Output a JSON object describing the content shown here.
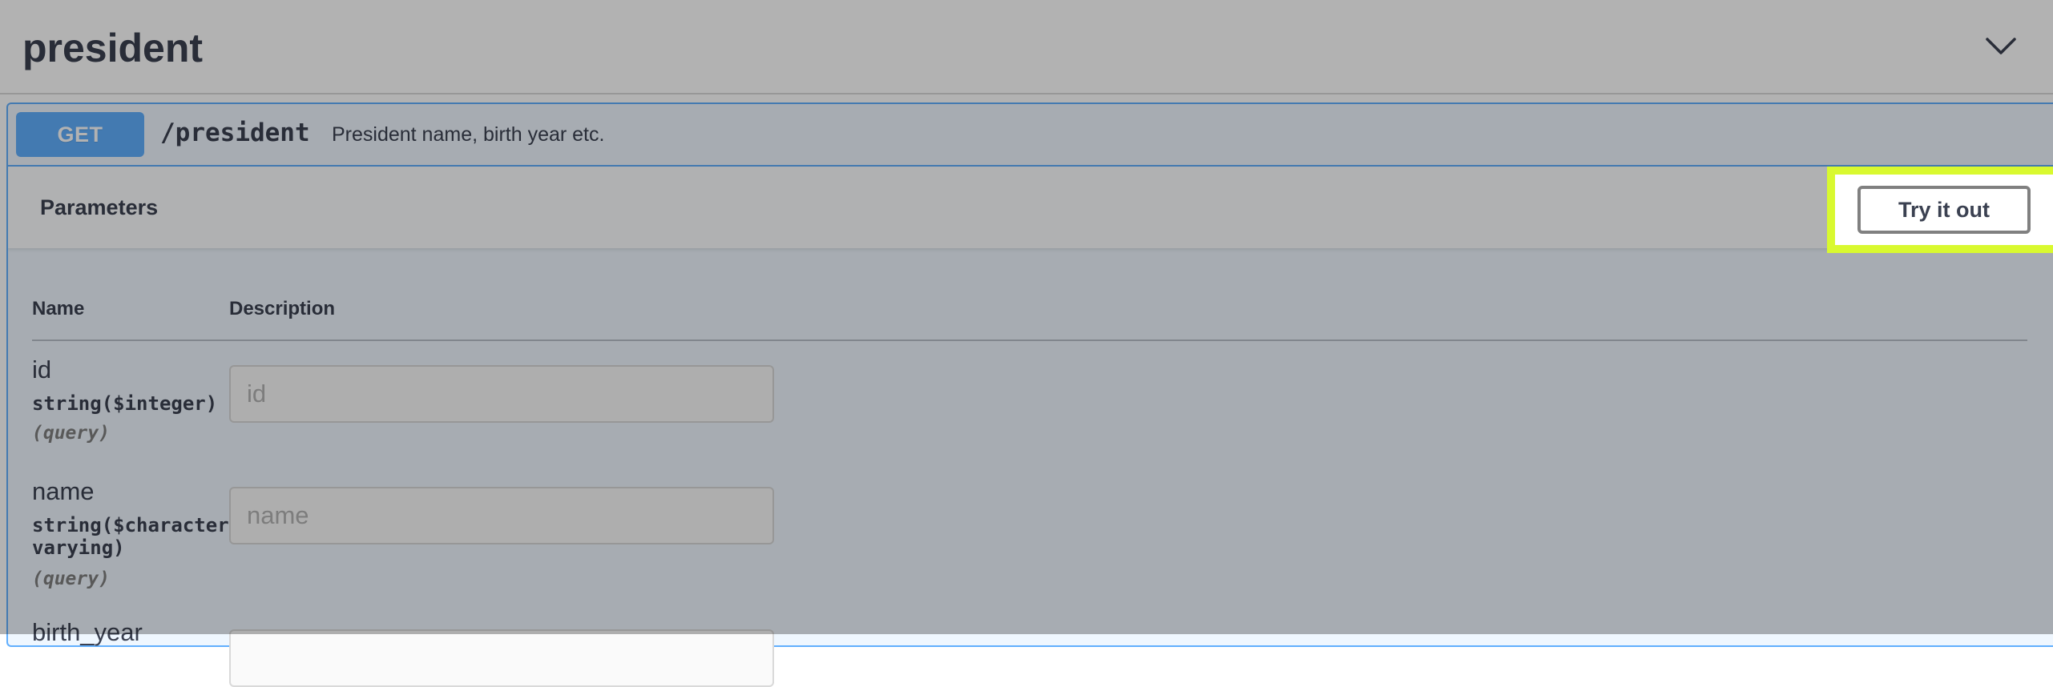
{
  "tag": {
    "title": "president",
    "toggle_icon": "chevron-down-icon"
  },
  "operation": {
    "method": "GET",
    "path": "/president",
    "summary": "President name, birth year etc.",
    "accent_color": "#61affe"
  },
  "parameters": {
    "section_title": "Parameters",
    "try_it_out_label": "Try it out",
    "highlight_color": "#d9f92f",
    "columns": [
      "Name",
      "Description"
    ],
    "rows": [
      {
        "name": "id",
        "type": "string($integer)",
        "in": "(query)",
        "placeholder": "id",
        "value": ""
      },
      {
        "name": "name",
        "type": "string($character varying)",
        "in": "(query)",
        "placeholder": "name",
        "value": ""
      },
      {
        "name": "birth_year",
        "type": "",
        "in": "",
        "placeholder": "",
        "value": ""
      }
    ]
  }
}
